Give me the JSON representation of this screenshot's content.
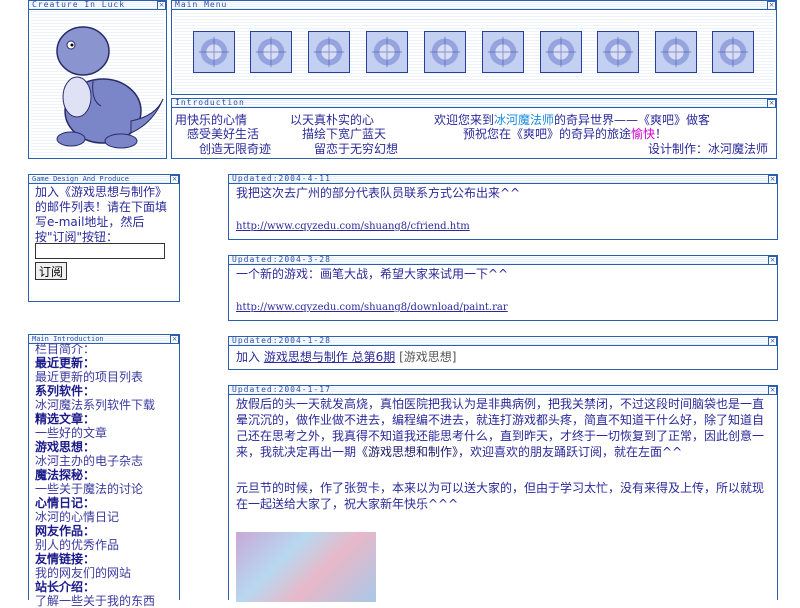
{
  "creature_panel": {
    "title": "Creature In Luck"
  },
  "main_menu": {
    "title": "Main Menu",
    "icons": [
      "figures-icon",
      "rose-window-icon",
      "treasure-chest-icon",
      "eye-icon",
      "hooded-figure-icon",
      "candle-icon",
      "chalice-icon",
      "wings-icon",
      "mask-face-icon",
      "crest-icon"
    ]
  },
  "intro_panel": {
    "title": "Introduction",
    "col1": [
      "用快乐的心情",
      "感受美好生活",
      "创造无限奇迹"
    ],
    "col2": [
      "以天真朴实的心",
      "描绘下宽广蓝天",
      "留恋于无穷幻想"
    ],
    "welcome_prefix": "欢迎您来到",
    "welcome_site": "冰河魔法师",
    "welcome_suffix": "的奇异世界——《爽吧》做客",
    "preview_text": "预祝您在《爽吧》的奇异的旅途",
    "preview_happy": "愉快",
    "preview_end": "！",
    "designer": "设计制作：冰河魔法师"
  },
  "subscribe": {
    "title": "Game Design And Produce",
    "lines": [
      "加入《游戏思想与制作》",
      "的邮件列表！请在下面填",
      "写e-mail地址，然后",
      "按\"订阅\"按钮："
    ],
    "input_value": "",
    "button_label": "订阅"
  },
  "main_intro": {
    "title": "Main Introduction",
    "header": "栏目简介：",
    "sections": [
      {
        "name": "最近更新：",
        "desc": "最近更新的项目列表"
      },
      {
        "name": "系列软件：",
        "desc": "冰河魔法系列软件下载"
      },
      {
        "name": "精选文章：",
        "desc": "一些好的文章"
      },
      {
        "name": "游戏思想：",
        "desc": "冰河主办的电子杂志"
      },
      {
        "name": "魔法探秘：",
        "desc": "一些关于魔法的讨论"
      },
      {
        "name": "心情日记：",
        "desc": "冰河的心情日记"
      },
      {
        "name": "网友作品：",
        "desc": "别人的优秀作品"
      },
      {
        "name": "友情链接：",
        "desc": "我的网友们的网站"
      },
      {
        "name": "站长介绍：",
        "desc": "了解一些关于我的东西"
      }
    ]
  },
  "posts": [
    {
      "date": "Updated:2004-4-11",
      "text": "我把这次去广州的部分代表队员联系方式公布出来^^",
      "url": "http://www.cqyzedu.com/shuang8/cfriend.htm"
    },
    {
      "date": "Updated:2004-3-28",
      "text": "一个新的游戏：画笔大战，希望大家来试用一下^^",
      "url": "http://www.cqyzedu.com/shuang8/download/paint.rar"
    },
    {
      "date": "Updated:2004-1-28",
      "prefix": "加入 ",
      "link": "游戏思想与制作 总第6期",
      "suffix": " [游戏思想]"
    },
    {
      "date": "Updated:2004-1-17",
      "para1": "放假后的头一天就发高烧，真怕医院把我认为是非典病例，把我关禁闭，不过这段时间脑袋也是一直晕沉沉的，做作业做不进去，编程编不进去，就连打游戏都头疼，简直不知道干什么好，除了知道自己还在思考之外，我真得不知道我还能思考什么，直到昨天，才终于一切恢复到了正常，因此创意一来，我就决定再出一期",
      "para1_em": "《游戏思想和制作》",
      "para1_end": "，欢迎喜欢的朋友踊跃订阅，就在左面^^",
      "para2": "元旦节的时候，作了张贺卡，本来以为可以送大家的，但由于学习太忙，没有来得及上传，所以就现在一起送给大家了，祝大家新年快乐^^^"
    }
  ],
  "colors": {
    "border": "#2a5fb0",
    "text": "#2a2a9a",
    "accent_link": "#1a8ae0",
    "happy": "#cc00cc"
  }
}
